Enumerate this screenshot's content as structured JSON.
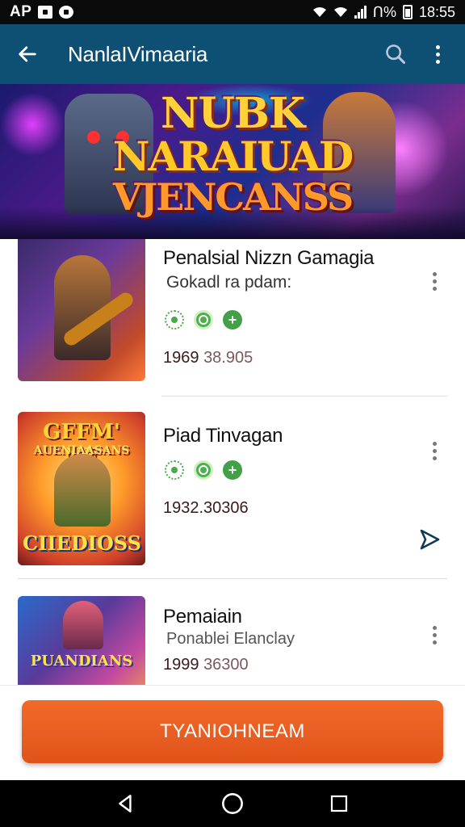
{
  "status_bar": {
    "carrier": "AP",
    "battery": "Ո%",
    "time": "18:55"
  },
  "app_bar": {
    "title": "NanlaIVimaaria"
  },
  "banner": {
    "line1": "NUBK",
    "line2": "NARAIUAD",
    "line3": "VJENCANSS"
  },
  "list": {
    "items": [
      {
        "title": "Penalsial Nizzn Gamagia",
        "subtitle": "Gokadl ra pdam:",
        "stat_a": "1969",
        "stat_b": "38.905",
        "thumb_caption": ""
      },
      {
        "title": "Piad Tinvagan",
        "subtitle": "",
        "stat_a": "1932.30306",
        "stat_b": "",
        "thumb_caption_top": "GFFM' NE",
        "thumb_caption_mid": "AUENIAASANS",
        "thumb_caption_bottom": "CIIEDIOSS"
      },
      {
        "title": "Pemaiain",
        "subtitle": "Ponablei Elanclay",
        "stat_a": "1999",
        "stat_b": "36300",
        "thumb_caption": "PUANDIANS"
      }
    ]
  },
  "cta": {
    "label": "TYANIOHNEAM"
  },
  "colors": {
    "app_bar": "#0e4f74",
    "cta": "#e85d20",
    "badge_green": "#43a047"
  }
}
